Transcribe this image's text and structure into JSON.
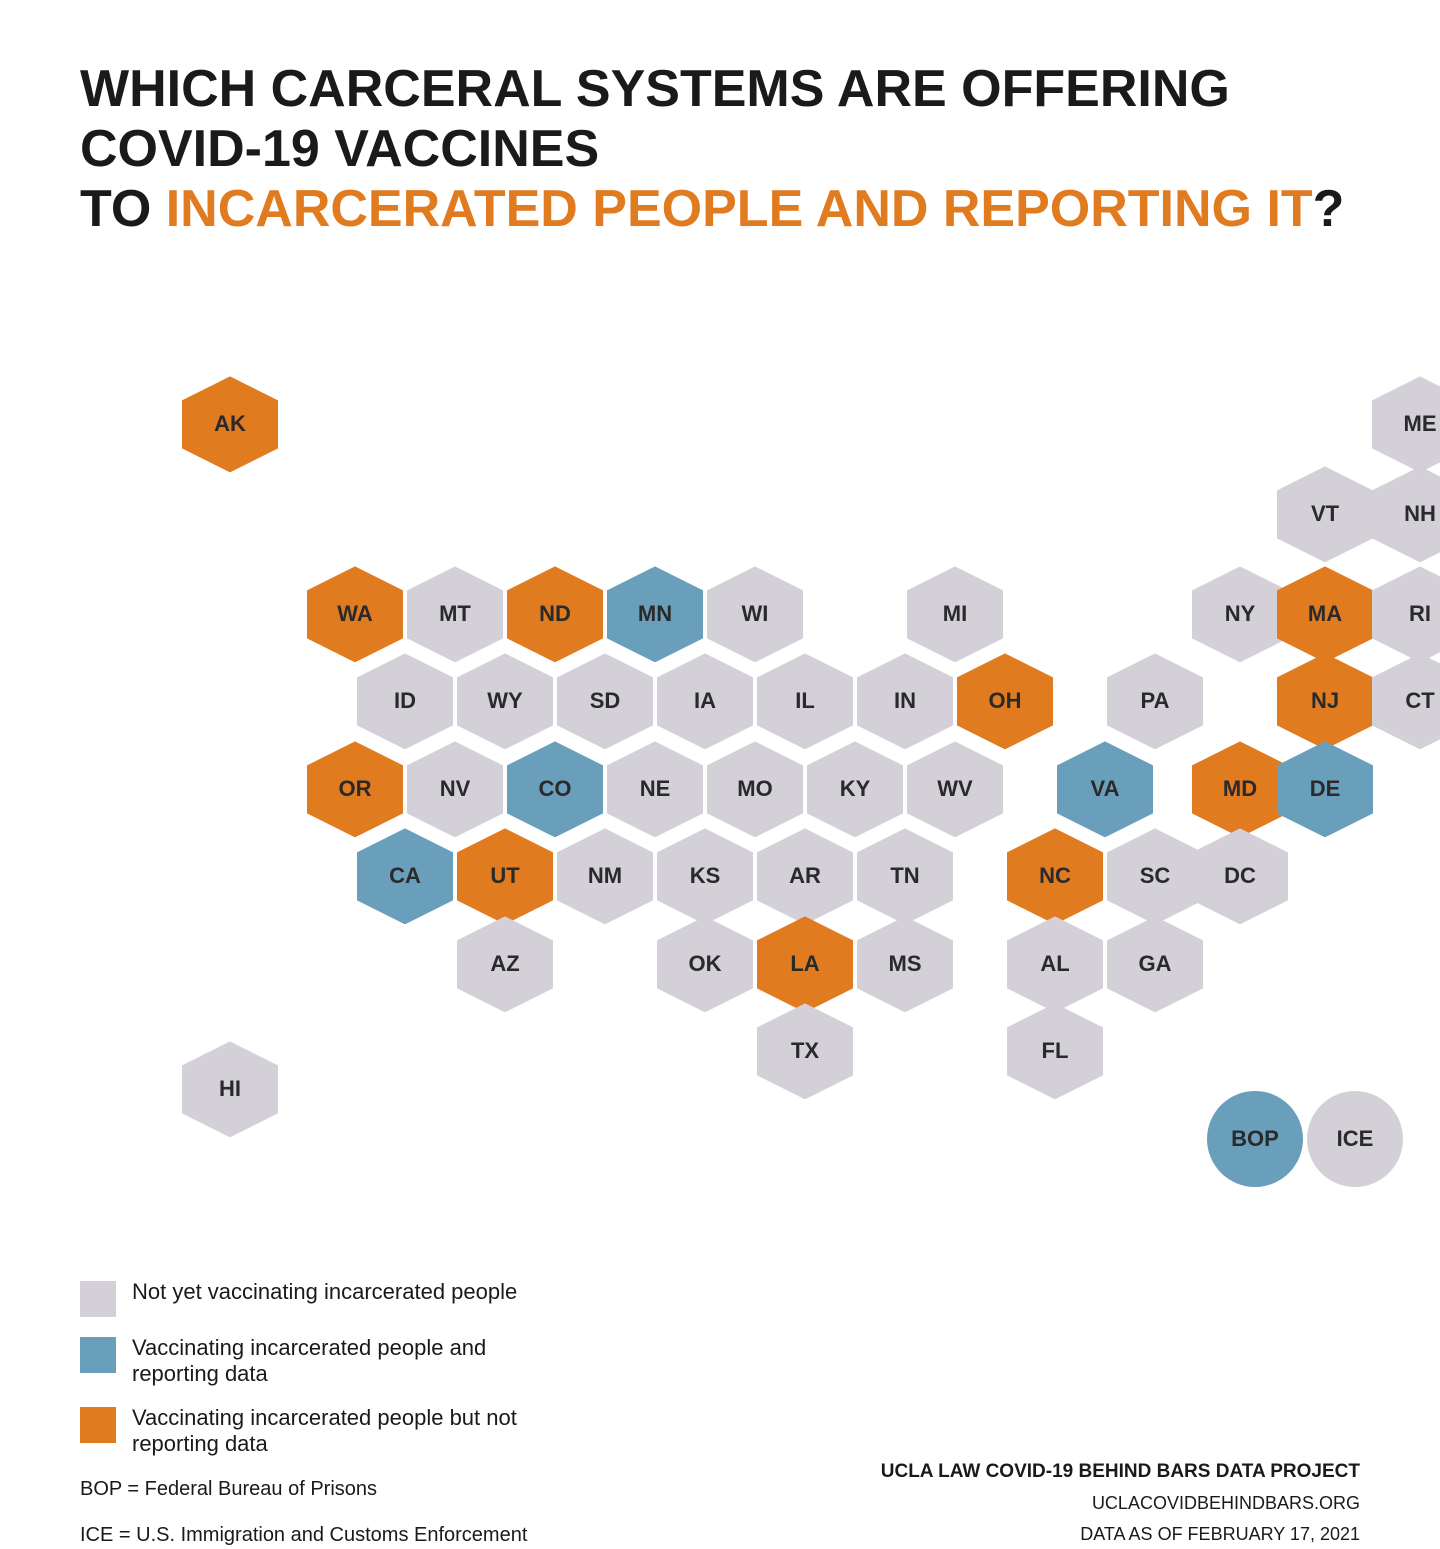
{
  "title": {
    "line1": "WHICH CARCERAL SYSTEMS ARE OFFERING COVID-19 VACCINES",
    "line2_plain": "TO ",
    "line2_highlight": "INCARCERATED PEOPLE AND REPORTING IT",
    "line2_end": "?"
  },
  "colors": {
    "gray": "#d4d0d8",
    "blue": "#6a9fbc",
    "orange": "#e07b20",
    "text": "#1a1a1a",
    "highlight": "#e07b20"
  },
  "legend": {
    "items": [
      {
        "color": "gray",
        "label": "Not yet vaccinating incarcerated people"
      },
      {
        "color": "blue",
        "label": "Vaccinating incarcerated people and reporting data"
      },
      {
        "color": "orange",
        "label": "Vaccinating incarcerated people but not reporting data"
      }
    ],
    "notes": [
      "BOP = Federal Bureau of Prisons",
      "ICE = U.S. Immigration and Customs Enforcement"
    ]
  },
  "attribution": {
    "org": "UCLA LAW COVID-19 BEHIND BARS DATA PROJECT",
    "url": "UCLACOVIDBEHINDBARS.ORG",
    "date": "DATA AS OF FEBRUARY 17, 2021"
  },
  "states": [
    {
      "id": "AK",
      "color": "orange",
      "col": 0,
      "row": 0,
      "type": "hex"
    },
    {
      "id": "HI",
      "color": "gray",
      "col": 0,
      "row": 8,
      "type": "hex"
    },
    {
      "id": "ME",
      "color": "gray",
      "col": 14,
      "row": 0,
      "type": "hex"
    },
    {
      "id": "VT",
      "color": "gray",
      "col": 13,
      "row": 1,
      "type": "hex"
    },
    {
      "id": "NH",
      "color": "gray",
      "col": 14,
      "row": 1,
      "type": "hex"
    },
    {
      "id": "WA",
      "color": "orange",
      "col": 2,
      "row": 2,
      "type": "hex"
    },
    {
      "id": "MT",
      "color": "gray",
      "col": 3,
      "row": 2,
      "type": "hex"
    },
    {
      "id": "ND",
      "color": "orange",
      "col": 4,
      "row": 2,
      "type": "hex"
    },
    {
      "id": "MN",
      "color": "blue",
      "col": 5,
      "row": 2,
      "type": "hex"
    },
    {
      "id": "WI",
      "color": "gray",
      "col": 6,
      "row": 2,
      "type": "hex"
    },
    {
      "id": "MI",
      "color": "gray",
      "col": 9,
      "row": 2,
      "type": "hex"
    },
    {
      "id": "NY",
      "color": "gray",
      "col": 12,
      "row": 2,
      "type": "hex"
    },
    {
      "id": "MA",
      "color": "orange",
      "col": 13,
      "row": 2,
      "type": "hex"
    },
    {
      "id": "RI",
      "color": "gray",
      "col": 14,
      "row": 2,
      "type": "hex"
    },
    {
      "id": "ID",
      "color": "gray",
      "col": 2,
      "row": 3,
      "type": "hex"
    },
    {
      "id": "WY",
      "color": "gray",
      "col": 3,
      "row": 3,
      "type": "hex"
    },
    {
      "id": "SD",
      "color": "gray",
      "col": 4,
      "row": 3,
      "type": "hex"
    },
    {
      "id": "IA",
      "color": "gray",
      "col": 5,
      "row": 3,
      "type": "hex"
    },
    {
      "id": "IL",
      "color": "gray",
      "col": 6,
      "row": 3,
      "type": "hex"
    },
    {
      "id": "IN",
      "color": "gray",
      "col": 7,
      "row": 3,
      "type": "hex"
    },
    {
      "id": "OH",
      "color": "orange",
      "col": 9,
      "row": 3,
      "type": "hex"
    },
    {
      "id": "PA",
      "color": "gray",
      "col": 11,
      "row": 3,
      "type": "hex"
    },
    {
      "id": "NJ",
      "color": "orange",
      "col": 13,
      "row": 3,
      "type": "hex"
    },
    {
      "id": "CT",
      "color": "gray",
      "col": 14,
      "row": 3,
      "type": "hex"
    },
    {
      "id": "OR",
      "color": "orange",
      "col": 2,
      "row": 4,
      "type": "hex"
    },
    {
      "id": "NV",
      "color": "gray",
      "col": 3,
      "row": 4,
      "type": "hex"
    },
    {
      "id": "CO",
      "color": "blue",
      "col": 4,
      "row": 4,
      "type": "hex"
    },
    {
      "id": "NE",
      "color": "gray",
      "col": 5,
      "row": 4,
      "type": "hex"
    },
    {
      "id": "MO",
      "color": "gray",
      "col": 6,
      "row": 4,
      "type": "hex"
    },
    {
      "id": "KY",
      "color": "gray",
      "col": 7,
      "row": 4,
      "type": "hex"
    },
    {
      "id": "WV",
      "color": "gray",
      "col": 8,
      "row": 4,
      "type": "hex"
    },
    {
      "id": "VA",
      "color": "blue",
      "col": 10,
      "row": 4,
      "type": "hex"
    },
    {
      "id": "MD",
      "color": "orange",
      "col": 12,
      "row": 4,
      "type": "hex"
    },
    {
      "id": "DE",
      "color": "blue",
      "col": 13,
      "row": 4,
      "type": "hex"
    },
    {
      "id": "CA",
      "color": "blue",
      "col": 2,
      "row": 5,
      "type": "hex"
    },
    {
      "id": "UT",
      "color": "orange",
      "col": 3,
      "row": 5,
      "type": "hex"
    },
    {
      "id": "NM",
      "color": "gray",
      "col": 4,
      "row": 5,
      "type": "hex"
    },
    {
      "id": "KS",
      "color": "gray",
      "col": 5,
      "row": 5,
      "type": "hex"
    },
    {
      "id": "AR",
      "color": "gray",
      "col": 6,
      "row": 5,
      "type": "hex"
    },
    {
      "id": "TN",
      "color": "gray",
      "col": 7,
      "row": 5,
      "type": "hex"
    },
    {
      "id": "NC",
      "color": "orange",
      "col": 9,
      "row": 5,
      "type": "hex"
    },
    {
      "id": "SC",
      "color": "gray",
      "col": 10,
      "row": 5,
      "type": "hex"
    },
    {
      "id": "DC",
      "color": "gray",
      "col": 11,
      "row": 5,
      "type": "hex"
    },
    {
      "id": "AZ",
      "color": "gray",
      "col": 3,
      "row": 6,
      "type": "hex"
    },
    {
      "id": "OK",
      "color": "gray",
      "col": 5,
      "row": 6,
      "type": "hex"
    },
    {
      "id": "LA",
      "color": "orange",
      "col": 6,
      "row": 6,
      "type": "hex"
    },
    {
      "id": "MS",
      "color": "gray",
      "col": 7,
      "row": 6,
      "type": "hex"
    },
    {
      "id": "AL",
      "color": "gray",
      "col": 9,
      "row": 6,
      "type": "hex"
    },
    {
      "id": "GA",
      "color": "gray",
      "col": 10,
      "row": 6,
      "type": "hex"
    },
    {
      "id": "TX",
      "color": "gray",
      "col": 6,
      "row": 7,
      "type": "hex"
    },
    {
      "id": "FL",
      "color": "gray",
      "col": 9,
      "row": 7,
      "type": "hex"
    },
    {
      "id": "BOP",
      "color": "blue",
      "col": 13,
      "row": 8,
      "type": "circle"
    },
    {
      "id": "ICE",
      "color": "gray",
      "col": 14,
      "row": 8,
      "type": "circle"
    }
  ]
}
